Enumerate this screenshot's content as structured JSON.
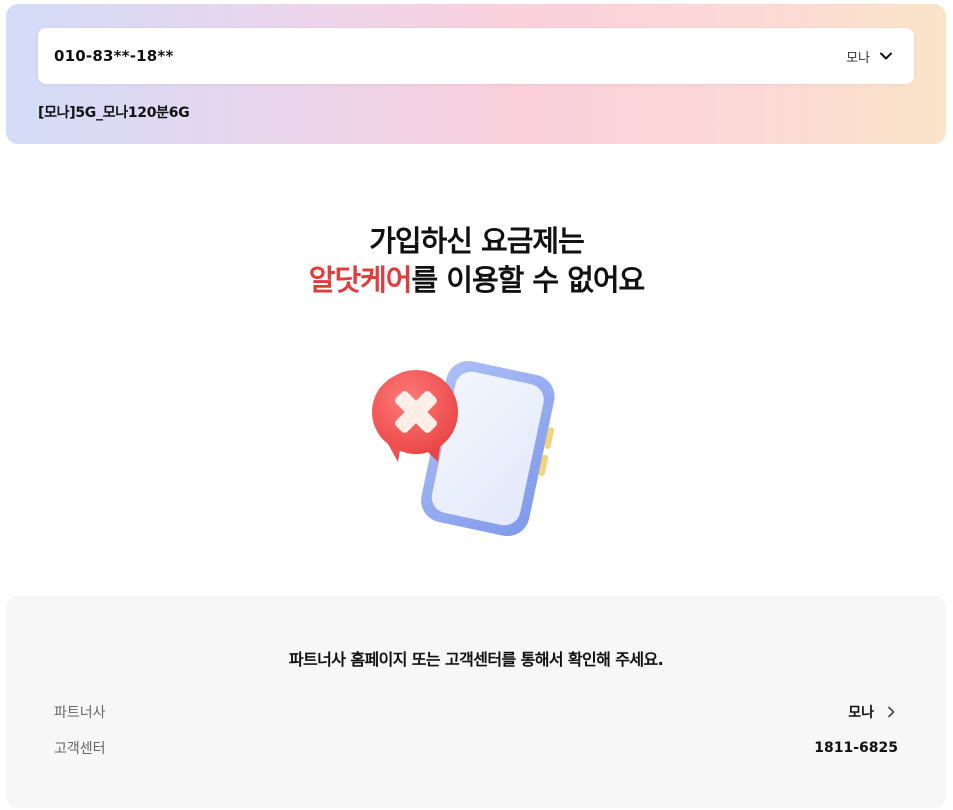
{
  "line": {
    "phone_number": "010-83**-18**",
    "carrier": "모나",
    "plan": "[모나]5G_모나120분6G"
  },
  "message": {
    "line1": "가입하신 요금제는",
    "line2_accent": "알닷케어",
    "line2_rest": "를 이용할 수 없어요"
  },
  "illustration": {
    "icon": "phone-with-error-x-icon"
  },
  "info": {
    "title": "파트너사 홈페이지 또는 고객센터를 통해서 확인해 주세요.",
    "partner_label": "파트너사",
    "partner_value": "모나",
    "center_label": "고객센터",
    "center_value": "1811-6825"
  },
  "colors": {
    "accent": "#e03e3e",
    "info_bg": "#f7f7f7",
    "phone_body": "#8fa8ef"
  }
}
